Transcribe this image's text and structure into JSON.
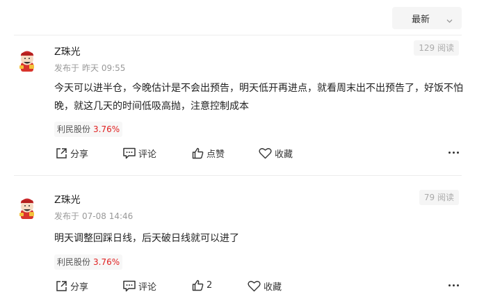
{
  "sort": {
    "selected": "最新"
  },
  "posts": [
    {
      "author": "Z珠光",
      "published_prefix": "发布于",
      "published_time": "昨天 09:55",
      "reads": "129 阅读",
      "content": "今天可以进半仓，今晚估计是不会出预告，明天低开再进点，就看周末出不出预告了，好饭不怕晚，就这几天的时间低吸高抛，注意控制成本",
      "stock_name": "利民股份",
      "stock_change": "3.76%",
      "actions": {
        "share": "分享",
        "comment": "评论",
        "like": "点赞",
        "favorite": "收藏"
      }
    },
    {
      "author": "Z珠光",
      "published_prefix": "发布于",
      "published_time": "07-08 14:46",
      "reads": "79 阅读",
      "content": "明天调整回踩日线，后天破日线就可以进了",
      "stock_name": "利民股份",
      "stock_change": "3.76%",
      "actions": {
        "share": "分享",
        "comment": "评论",
        "like": "2",
        "favorite": "收藏"
      }
    }
  ],
  "colors": {
    "accent_red": "#e02020",
    "muted": "#999999"
  }
}
